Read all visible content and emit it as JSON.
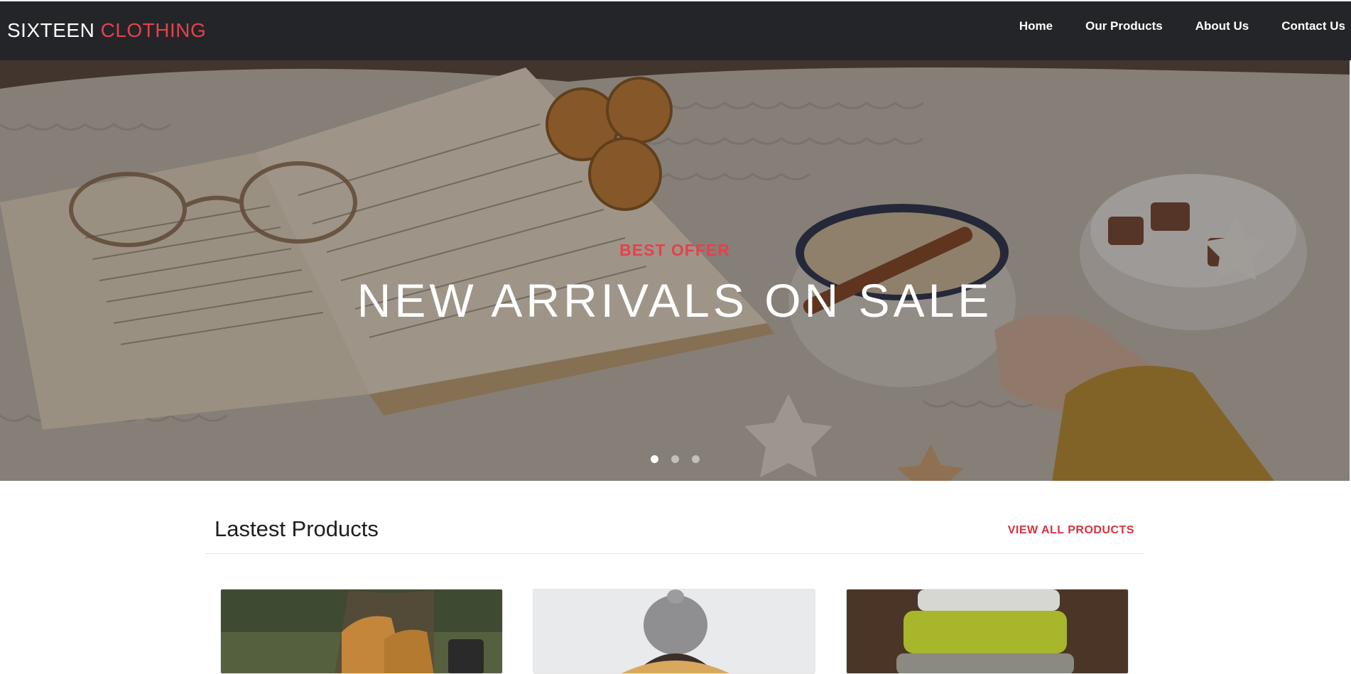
{
  "brand": {
    "name": "SIXTEEN",
    "accent": "CLOTHING"
  },
  "nav": {
    "items": [
      {
        "label": "Home"
      },
      {
        "label": "Our Products"
      },
      {
        "label": "About Us"
      },
      {
        "label": "Contact Us"
      }
    ]
  },
  "hero": {
    "eyebrow": "BEST OFFER",
    "title": "NEW ARRIVALS ON SALE",
    "slides_count": 3,
    "active_slide": 1
  },
  "latest": {
    "title": "Lastest Products",
    "view_all": "VIEW ALL PRODUCTS"
  },
  "colors": {
    "accent": "#e4414d",
    "navbar": "#232528"
  }
}
